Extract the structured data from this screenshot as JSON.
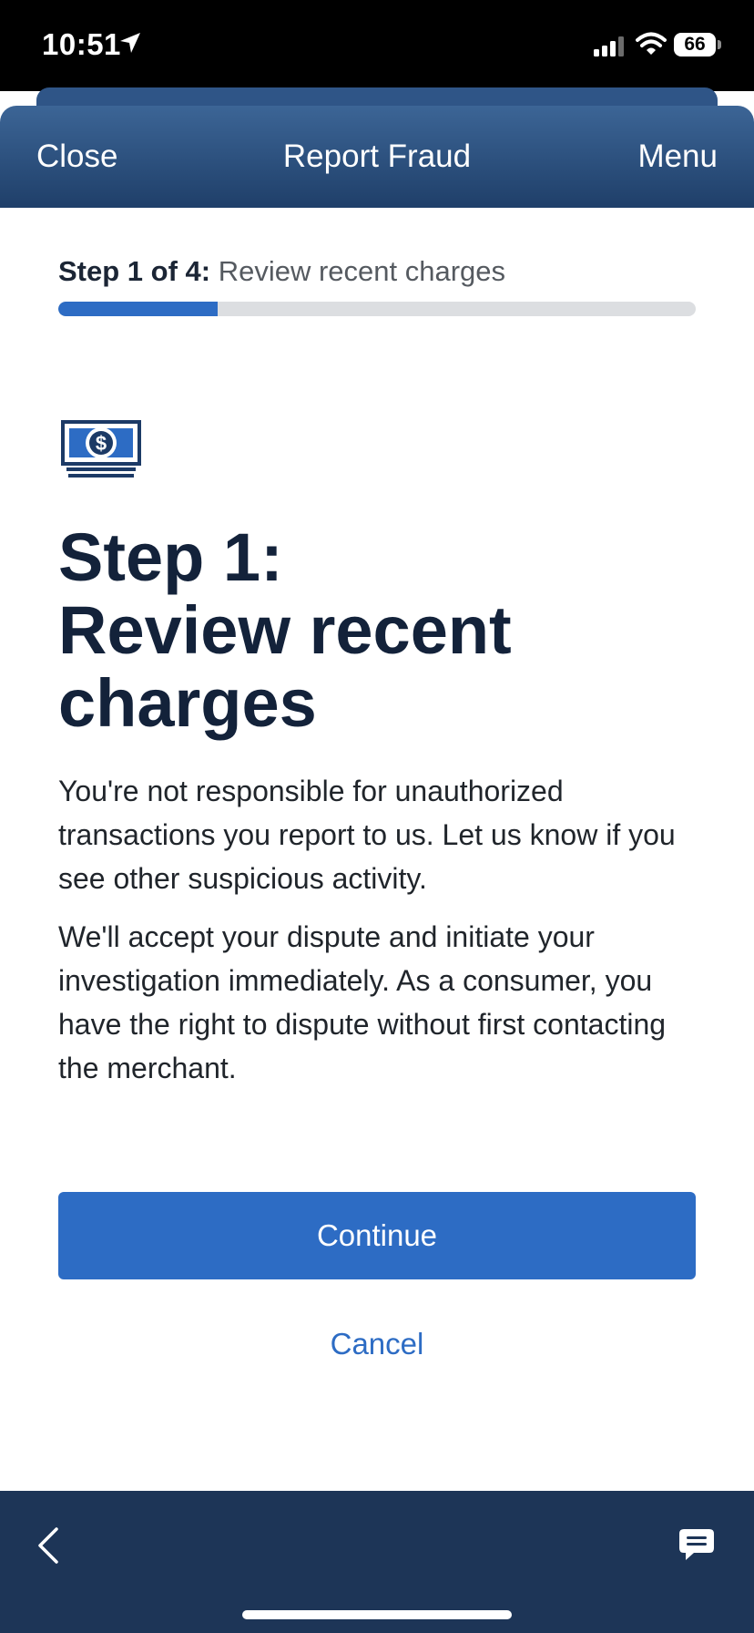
{
  "status_bar": {
    "time": "10:51",
    "battery": "66",
    "icons": [
      "location-arrow-icon",
      "signal-icon",
      "wifi-icon",
      "battery-icon"
    ]
  },
  "header": {
    "close_label": "Close",
    "title": "Report Fraud",
    "menu_label": "Menu"
  },
  "progress": {
    "step_prefix": "Step 1 of 4:",
    "step_name": " Review recent charges",
    "current_step": 1,
    "total_steps": 4,
    "fraction_complete": 0.25
  },
  "main": {
    "icon": "money-bill-icon",
    "heading_line1": "Step 1:",
    "heading_line2": "Review recent",
    "heading_line3": "charges",
    "paragraph1": "You're not responsible for unauthorized transactions you report to us. Let us know if you see other suspicious activity.",
    "paragraph2": "We'll accept your dispute and initiate your investigation immediately. As a consumer, you have the right to dispute without first contacting the merchant.",
    "continue_label": "Continue",
    "cancel_label": "Cancel"
  },
  "bottom_bar": {
    "icons": [
      "back-chevron-icon",
      "chat-icon"
    ]
  },
  "colors": {
    "accent": "#2d6cc4",
    "header_top": "#3c6596",
    "header_bottom": "#1f3f69",
    "bottom_bar": "#1d3557",
    "heading_text": "#13223a"
  }
}
